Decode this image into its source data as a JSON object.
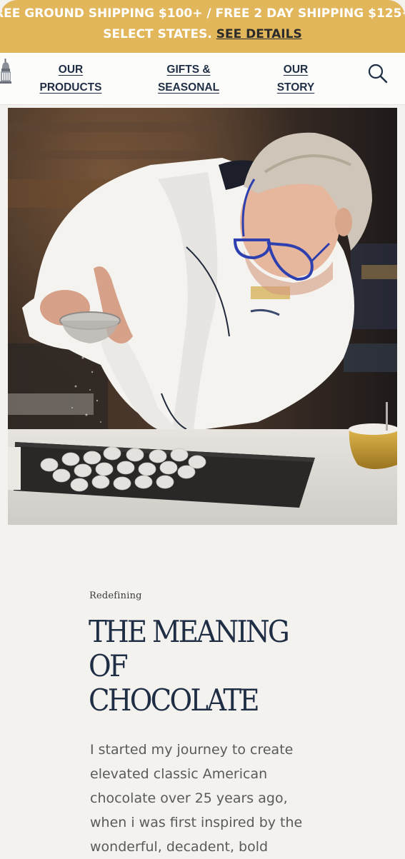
{
  "promo": {
    "line1": "REE GROUND SHIPPING $100+ / FREE 2 DAY SHIPPING $125+ T",
    "line2_prefix": "SELECT STATES.",
    "details_link": "SEE DETAILS",
    "background_color": "#e2b65b"
  },
  "nav": {
    "logo_icon": "capitol-dome-icon",
    "items": [
      {
        "line1": "OUR",
        "line2": "PRODUCTS"
      },
      {
        "line1": "GIFTS &",
        "line2": "SEASONAL"
      },
      {
        "line1": "OUR",
        "line2": "STORY"
      }
    ],
    "search_icon": "search-icon",
    "text_color": "#1f2e44"
  },
  "hero": {
    "subject": "chocolatier-dusting-truffles-photo"
  },
  "content": {
    "eyebrow": "Redefining",
    "headline_lines": [
      "THE MEANING",
      "OF",
      "CHOCOLATE"
    ],
    "body": "I started my journey to create elevated classic American chocolate over 25 years ago, when i was first inspired by the wonderful, decadent, bold"
  }
}
